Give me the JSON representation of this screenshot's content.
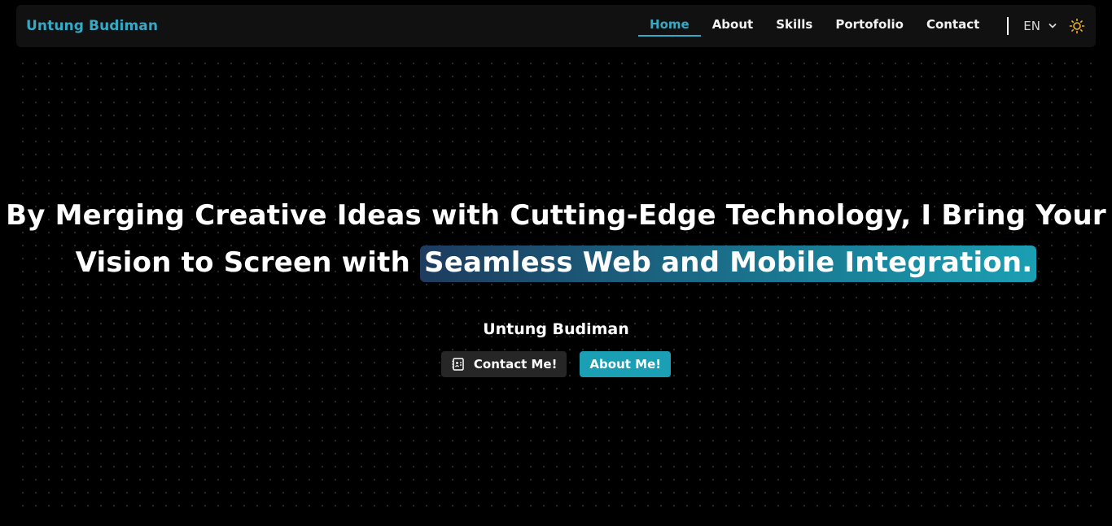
{
  "nav": {
    "brand": "Untung Budiman",
    "links": [
      "Home",
      "About",
      "Skills",
      "Portofolio",
      "Contact"
    ],
    "active": "Home",
    "language": "EN",
    "theme_icon": "sun-icon"
  },
  "hero": {
    "headline_part1": "By Merging Creative Ideas with Cutting-Edge Technology, I Bring Your Vision to Screen with ",
    "headline_highlight": "Seamless Web and Mobile Integration.",
    "author": "Untung Budiman",
    "contact_button": "Contact Me!",
    "about_button": "About Me!"
  },
  "colors": {
    "accent": "#36a9c6",
    "button_accent": "#1a9fb5",
    "background": "#000000",
    "navbar": "#111111",
    "sun": "#f0b323"
  }
}
